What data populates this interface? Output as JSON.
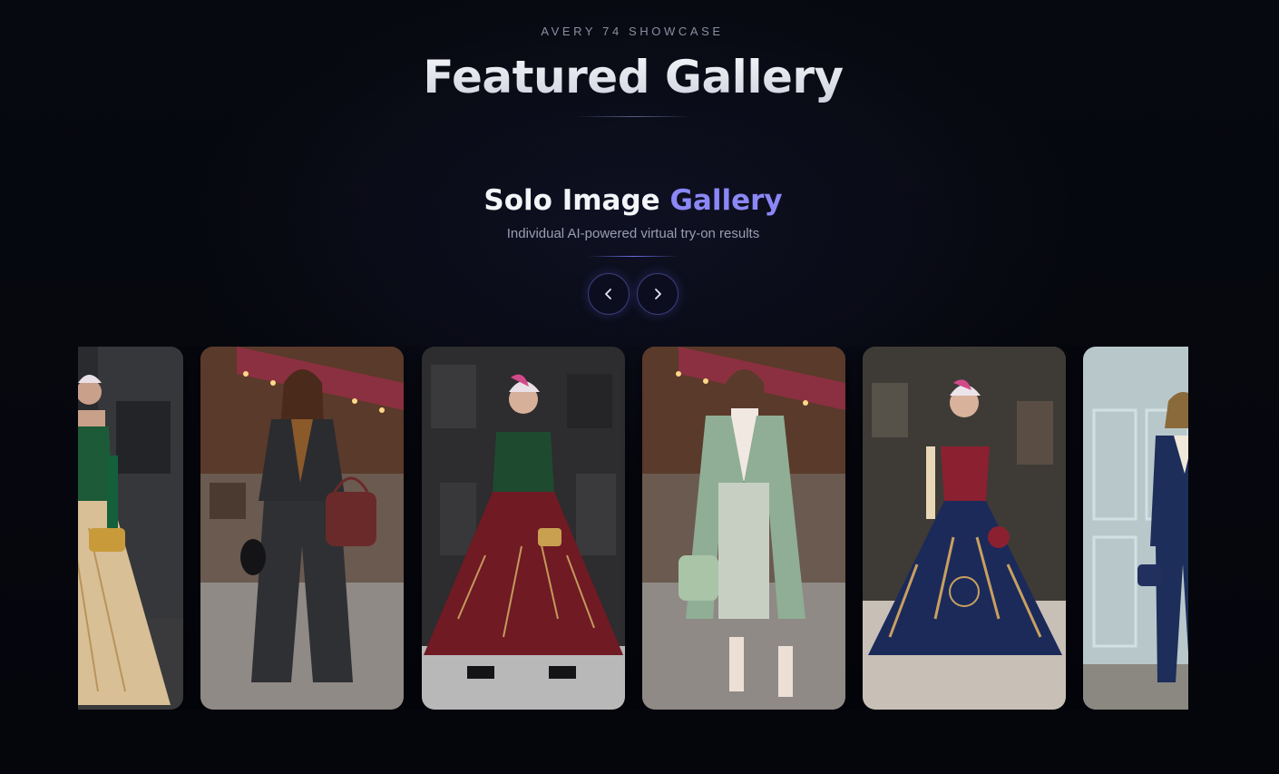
{
  "header": {
    "eyebrow": "AVERY 74 SHOWCASE",
    "title": "Featured Gallery"
  },
  "section": {
    "title_main": "Solo Image",
    "title_accent": "Gallery",
    "subtitle": "Individual AI-powered virtual try-on results"
  },
  "controls": {
    "prev_icon": "chevron-left-icon",
    "next_icon": "chevron-right-icon"
  },
  "colors": {
    "background": "#05060c",
    "accent": "#8b87f6",
    "button_border": "#3b3b7a"
  },
  "gallery": {
    "items": [
      {
        "outfit": "green-vest-gold-gown",
        "background": "dark-stone-wall"
      },
      {
        "outfit": "charcoal-shirt-suspenders-trousers",
        "background": "street-cafe"
      },
      {
        "outfit": "green-bodice-burgundy-gown",
        "background": "dark-stone-wall"
      },
      {
        "outfit": "sage-coat-tweed-skirt",
        "background": "street-cafe"
      },
      {
        "outfit": "red-corset-navy-ballgown",
        "background": "ornate-stone-wall"
      },
      {
        "outfit": "navy-pantsuit-scarf",
        "background": "pale-blue-paneled-wall"
      }
    ]
  }
}
